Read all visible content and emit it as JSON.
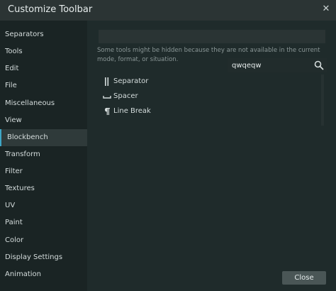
{
  "dialog": {
    "title": "Customize Toolbar",
    "close_icon": "close-icon"
  },
  "sidebar": {
    "items": [
      {
        "label": "Separators"
      },
      {
        "label": "Tools"
      },
      {
        "label": "Edit"
      },
      {
        "label": "File"
      },
      {
        "label": "Miscellaneous"
      },
      {
        "label": "View"
      },
      {
        "label": "Blockbench",
        "active": true
      },
      {
        "label": "Transform"
      },
      {
        "label": "Filter"
      },
      {
        "label": "Textures"
      },
      {
        "label": "UV"
      },
      {
        "label": "Paint"
      },
      {
        "label": "Color"
      },
      {
        "label": "Display Settings"
      },
      {
        "label": "Animation"
      }
    ]
  },
  "main": {
    "note": "Some tools might be hidden because they are not available in the current mode, format, or situation.",
    "search": {
      "value": "qwqeqw",
      "icon": "search-icon"
    },
    "tools": [
      {
        "label": "Separator",
        "icon": "separator-icon"
      },
      {
        "label": "Spacer",
        "icon": "spacer-icon"
      },
      {
        "label": "Line Break",
        "icon": "pilcrow-icon"
      }
    ],
    "close_label": "Close"
  },
  "colors": {
    "accent": "#3ea6c6",
    "background": "#1f2a2a",
    "sidebar": "#1a2424",
    "titlebar": "#2b3434",
    "button": "#4a5656"
  }
}
